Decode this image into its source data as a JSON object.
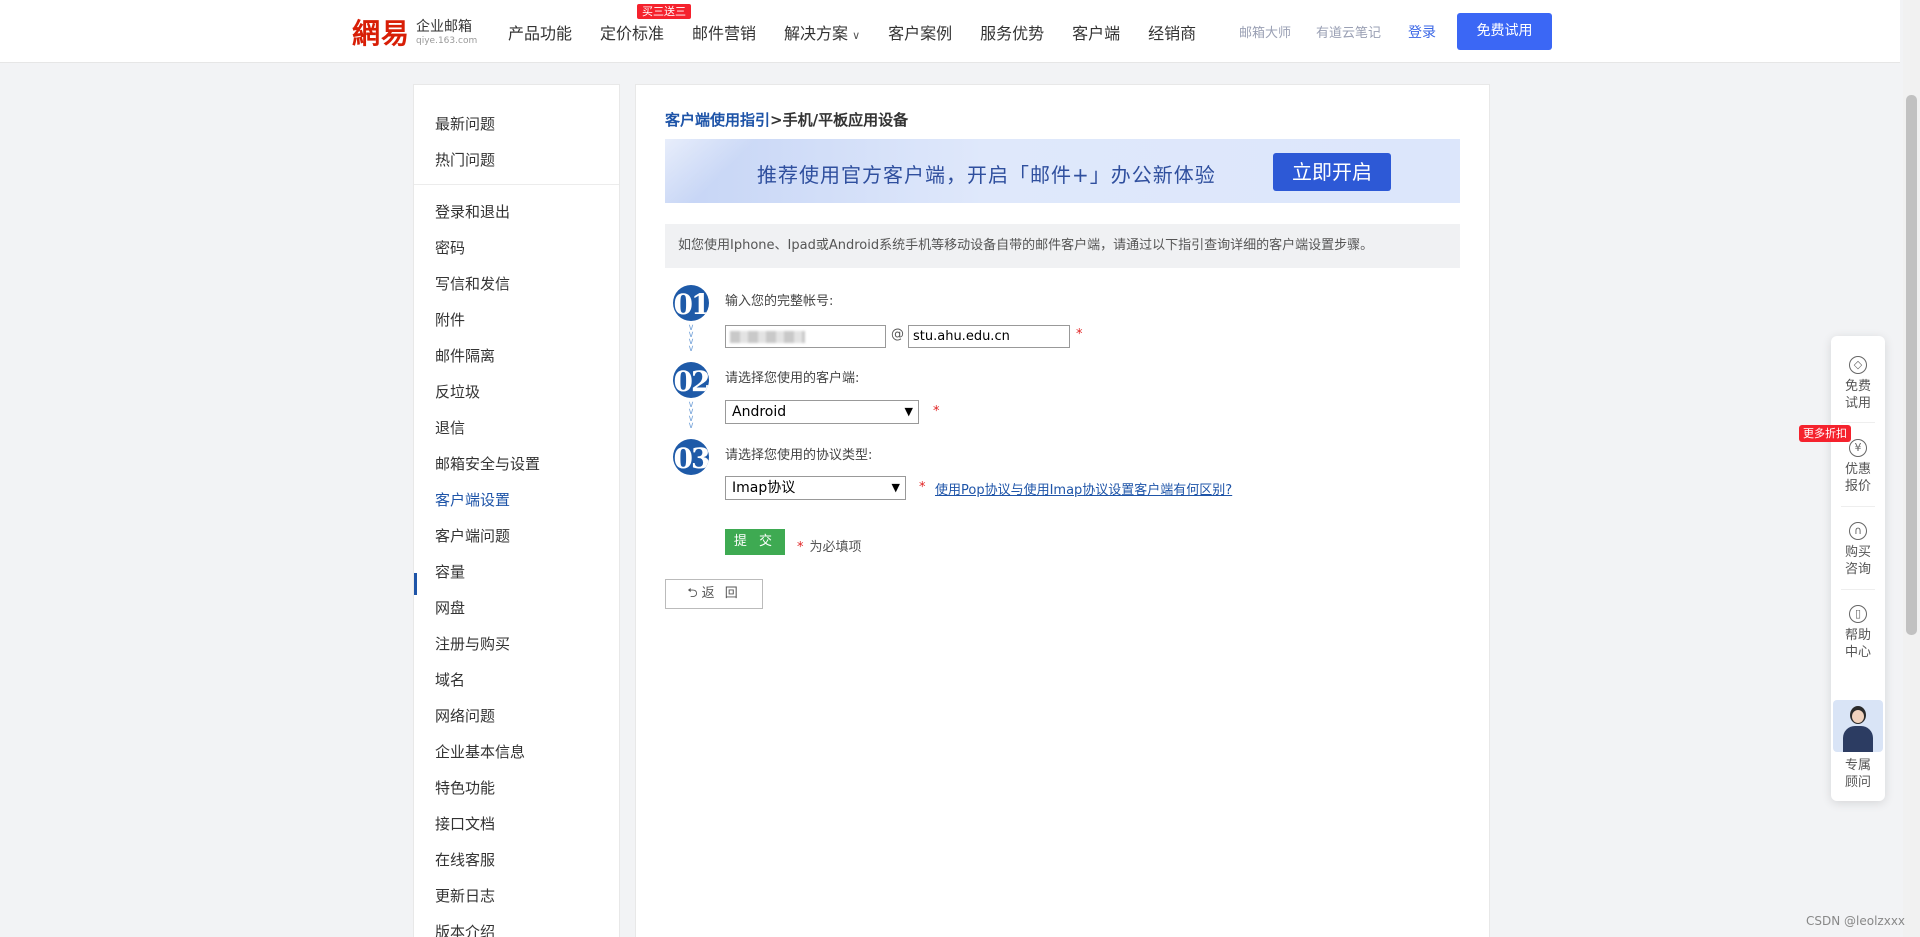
{
  "header": {
    "logo_mark": "網易",
    "logo_title": "企业邮箱",
    "logo_domain": "qiye.163.com",
    "nav": [
      {
        "label": "产品功能"
      },
      {
        "label": "定价标准"
      },
      {
        "label": "邮件营销"
      },
      {
        "label": "解决方案"
      },
      {
        "label": "客户案例"
      },
      {
        "label": "服务优势"
      },
      {
        "label": "客户端"
      },
      {
        "label": "经销商"
      }
    ],
    "promo_tag": "买三送三",
    "ext_links": [
      "邮箱大师",
      "有道云笔记"
    ],
    "login": "登录",
    "trial_button": "免费试用"
  },
  "sidebar": {
    "items": [
      "最新问题",
      "热门问题",
      "登录和退出",
      "密码",
      "写信和发信",
      "附件",
      "邮件隔离",
      "反垃圾",
      "退信",
      "邮箱安全与设置",
      "客户端设置",
      "客户端问题",
      "容量",
      "网盘",
      "注册与购买",
      "域名",
      "网络问题",
      "企业基本信息",
      "特色功能",
      "接口文档",
      "在线客服",
      "更新日志",
      "版本介绍"
    ],
    "active": "客户端设置"
  },
  "main": {
    "breadcrumb_link": "客户端使用指引",
    "breadcrumb_sep": ">",
    "breadcrumb_current": "手机/平板应用设备",
    "banner_text": "推荐使用官方客户端，开启「邮件+」办公新体验",
    "banner_button": "立即开启",
    "notice": "如您使用Iphone、Ipad或Android系统手机等移动设备自带的邮件客户端，请通过以下指引查询详细的客户端设置步骤。",
    "steps": [
      {
        "num": "01",
        "label": "输入您的完整帐号:"
      },
      {
        "num": "02",
        "label": "请选择您使用的客户端:"
      },
      {
        "num": "03",
        "label": "请选择您使用的协议类型:"
      }
    ],
    "at_sign": "@",
    "domain_value": "stu.ahu.edu.cn",
    "client_select": "Android",
    "protocol_select": "Imap协议",
    "required_mark": "*",
    "protocol_diff_link": "使用Pop协议与使用Imap协议设置客户端有何区别?",
    "submit": "提 交",
    "required_note": "为必填项",
    "back": "返 回",
    "back_arrow": "⮌"
  },
  "float_panel": {
    "items": [
      {
        "label1": "免费",
        "label2": "试用",
        "icon": "diamond-icon",
        "glyph": "◇"
      },
      {
        "label1": "优惠",
        "label2": "报价",
        "icon": "yuan-icon",
        "glyph": "¥"
      },
      {
        "label1": "购买",
        "label2": "咨询",
        "icon": "headset-icon",
        "glyph": "∩"
      },
      {
        "label1": "帮助",
        "label2": "中心",
        "icon": "book-icon",
        "glyph": "▯"
      }
    ],
    "badge": "更多折扣",
    "advisor_label1": "专属",
    "advisor_label2": "顾问"
  },
  "watermark": "CSDN @leolzxxx"
}
